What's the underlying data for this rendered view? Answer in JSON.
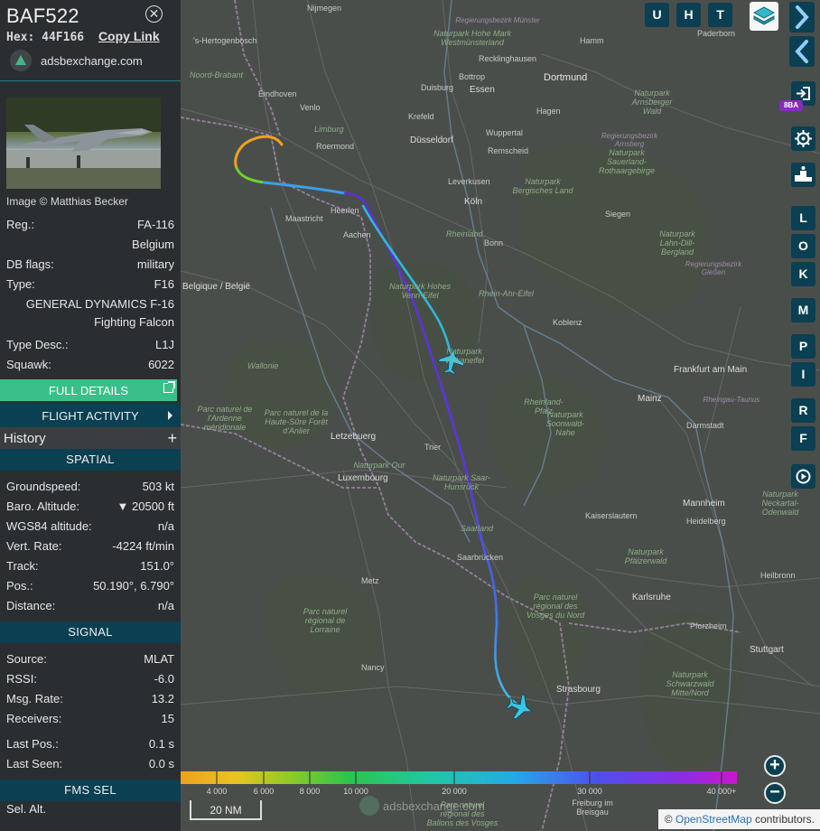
{
  "aircraft": {
    "callsign": "BAF522",
    "hex_label": "Hex:",
    "hex": "44F166",
    "copy_link": "Copy Link",
    "site": "adsbexchange.com",
    "image_credit": "Image © Matthias Becker",
    "reg_label": "Reg.:",
    "reg": "FA-116",
    "country": "Belgium",
    "dbflags_label": "DB flags:",
    "dbflags": "military",
    "type_label": "Type:",
    "type": "F16",
    "type_name_1": "GENERAL DYNAMICS F-16",
    "type_name_2": "Fighting Falcon",
    "typedesc_label": "Type Desc.:",
    "typedesc": "L1J",
    "squawk_label": "Squawk:",
    "squawk": "6022"
  },
  "buttons": {
    "full_details": "FULL DETAILS",
    "flight_activity": "FLIGHT ACTIVITY",
    "history": "History",
    "history_plus": "+"
  },
  "spatial": {
    "title": "SPATIAL",
    "groundspeed_label": "Groundspeed:",
    "groundspeed": "503 kt",
    "baro_label": "Baro. Altitude:",
    "baro": "▼ 20500 ft",
    "wgs_label": "WGS84 altitude:",
    "wgs": "n/a",
    "vrate_label": "Vert. Rate:",
    "vrate": "-4224 ft/min",
    "track_label": "Track:",
    "track": "151.0°",
    "pos_label": "Pos.:",
    "pos": "50.190°, 6.790°",
    "dist_label": "Distance:",
    "dist": "n/a"
  },
  "signal": {
    "title": "SIGNAL",
    "source_label": "Source:",
    "source": "MLAT",
    "rssi_label": "RSSI:",
    "rssi": "-6.0",
    "msgrate_label": "Msg. Rate:",
    "msgrate": "13.2",
    "receivers_label": "Receivers:",
    "receivers": "15",
    "lastpos_label": "Last Pos.:",
    "lastpos": "0.1 s",
    "lastseen_label": "Last Seen:",
    "lastseen": "0.0 s"
  },
  "fms": {
    "title": "FMS SEL",
    "peek": "Sel. Alt."
  },
  "map": {
    "top_buttons": [
      "U",
      "H",
      "T"
    ],
    "side_buttons": [
      "L",
      "O",
      "K",
      "M",
      "P",
      "I",
      "R",
      "F"
    ],
    "badge": "8BA",
    "scale": "20 NM",
    "watermark": "adsbexchange.com",
    "attrib_prefix": "©",
    "attrib_link": "OpenStreetMap",
    "attrib_suffix": "contributors.",
    "altitude_legend": [
      "4 000",
      "6 000",
      "8 000",
      "10 000",
      "20 000",
      "30 000",
      "40 000+"
    ],
    "places": {
      "nijmegen": "Nijmegen",
      "hertogenbosch": "'s-Hertogenbosch",
      "noord_brabant": "Noord-Brabant",
      "eindhoven": "Eindhoven",
      "limburg": "Limburg",
      "roermond": "Roermond",
      "venlo": "Venlo",
      "maastricht": "Maastricht",
      "heerlen": "Heerlen",
      "aachen": "Aachen",
      "krefeld": "Krefeld",
      "duisburg": "Duisburg",
      "dusseldorf": "Düsseldorf",
      "essen": "Essen",
      "bottrop": "Bottrop",
      "dortmund": "Dortmund",
      "hamm": "Hamm",
      "paderborn": "Paderborn",
      "munster": "Regierungsbezirk Münster",
      "westmunsterland": "Naturpark Hohe Mark Westmünsterland",
      "recklinghausen": "Recklinghausen",
      "hagen": "Hagen",
      "wuppertal": "Wuppertal",
      "remscheid": "Remscheid",
      "leverkusen": "Leverkusen",
      "koln": "Köln",
      "bonn": "Bonn",
      "siegen": "Siegen",
      "bergisches": "Naturpark Bergisches Land",
      "sauerland": "Naturpark Sauerland-Rothaargebirge",
      "arnsberg": "Regierungsbezirk Arnsberg",
      "arnsberger": "Naturpark Arnsberger Wald",
      "lahn": "Naturpark Lahn-Dill-Bergland",
      "giessen": "Regierungsbezirk Gießen",
      "rheinland": "Rheinland",
      "rheinahr": "Rhein-Ahr-Eifel",
      "koblenz": "Koblenz",
      "hohesvenn": "Naturpark Hohes Venn-Eifel",
      "belgique": "Belgique / België",
      "vulkaneifel": "Naturpark Vulkaneifel",
      "rheinlandpfalz": "Rheinland-Pfalz",
      "wallonie": "Wallonie",
      "frankfurt": "Frankfurt am Main",
      "mainz": "Mainz",
      "darmstadt": "Darmstadt",
      "wiesbaden": "Rheingau-Taunus",
      "soonwald": "Naturpark Soonwald-Nahe",
      "ardennes": "Parc naturel de l'Ardenne méridionale",
      "hautesure": "Parc naturel de la Haute-Sûre Forêt d'Anlier",
      "letzebuerg": "Letzebuerg",
      "luxembourg": "Luxembourg",
      "trier": "Trier",
      "naturpark_lux": "Naturpark Our",
      "saarhunsruck": "Naturpark Saar-Hunsrück",
      "saarland": "Saarland",
      "kaiserslautern": "Kaiserslautern",
      "mannheim": "Mannheim",
      "heidelberg": "Heidelberg",
      "odenwald": "Naturpark Neckartal-Odenwald",
      "saarbrucken": "Saarbrücken",
      "metz": "Metz",
      "vosges_nord": "Parc naturel régional des Vosges du Nord",
      "heilbronn": "Heilbronn",
      "pfalzerwald": "Naturpark Pfälzerwald",
      "karlsruhe": "Karlsruhe",
      "pforzheim": "Pforzheim",
      "stuttgart": "Stuttgart",
      "lorraine": "Parc naturel régional de Lorraine",
      "nancy": "Nancy",
      "strasbourg": "Strasbourg",
      "schwarzwald": "Naturpark Schwarzwald Mitte/Nord",
      "freiburg": "Freiburg im Breisgau",
      "ballons": "Parc naturel régional des Ballons des Vosges"
    }
  }
}
